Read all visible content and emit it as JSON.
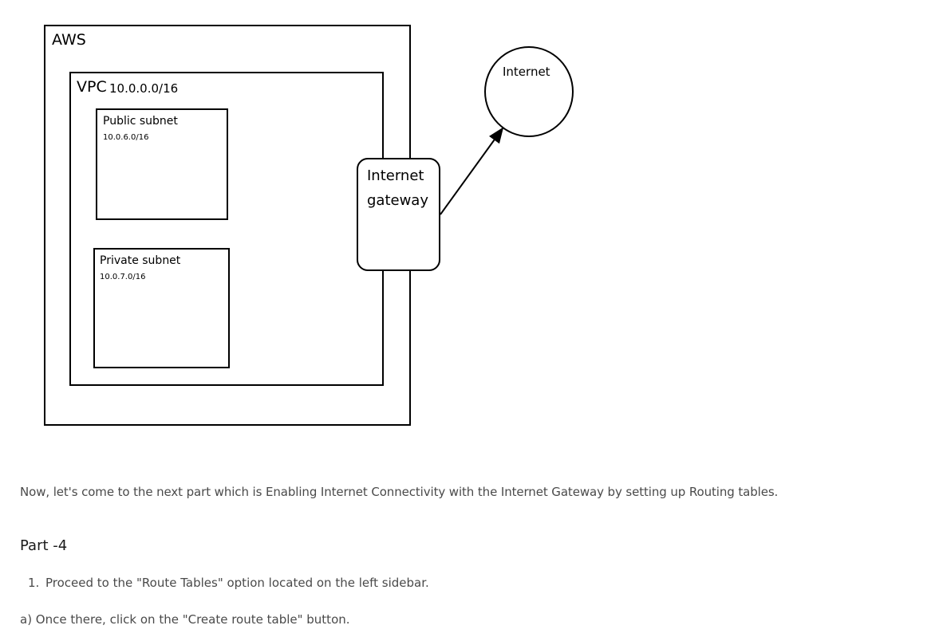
{
  "diagram": {
    "aws_label": "AWS",
    "vpc_label": "VPC",
    "vpc_cidr": "10.0.0.0/16",
    "public_subnet": {
      "label": "Public subnet",
      "cidr": "10.0.6.0/16"
    },
    "private_subnet": {
      "label": "Private subnet",
      "cidr": "10.0.7.0/16"
    },
    "igw_line1": "Internet",
    "igw_line2": "gateway",
    "internet_label": "Internet"
  },
  "article": {
    "intro": "Now, let's come to the next part which is Enabling Internet Connectivity with the Internet Gateway by setting up Routing tables.",
    "part_heading": "Part -4",
    "steps": [
      {
        "num": "1.",
        "text": "Proceed to the \"Route Tables\" option located on the left sidebar."
      }
    ],
    "substep_a": "a) Once there, click on the \"Create route table\" button."
  }
}
